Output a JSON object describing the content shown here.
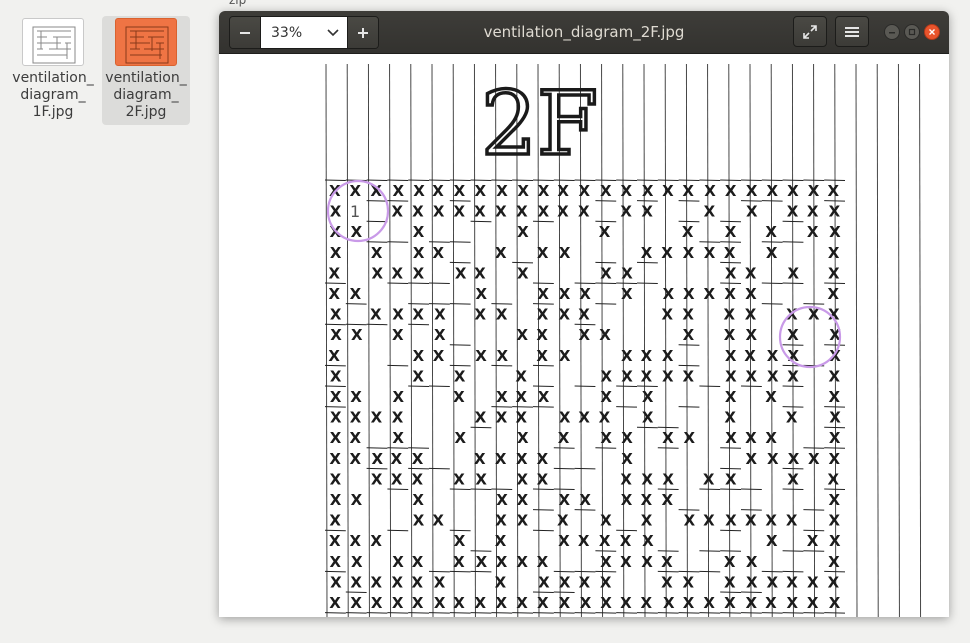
{
  "desktop": {
    "top_label": "zip",
    "files": [
      {
        "name": "ventilation_\ndiagram_\n1F.jpg",
        "selected": false
      },
      {
        "name": "ventilation_\ndiagram_\n2F.jpg",
        "selected": true
      }
    ]
  },
  "viewer": {
    "title": "ventilation_diagram_2F.jpg",
    "zoom": "33%",
    "icons": {
      "zoom_out": "minus-icon",
      "zoom_in": "plus-icon",
      "fullscreen": "fullscreen-icon",
      "menu": "hamburger-menu-icon",
      "minimize": "minimize-icon",
      "maximize": "maximize-icon",
      "close": "close-icon"
    }
  },
  "diagram": {
    "heading": "2F",
    "mark_1": "1",
    "grid_cols": 25,
    "grid_rows": 21,
    "cell_mark": "X",
    "accent_circle_color": "#c99ae8"
  },
  "colors": {
    "titlebar": "#3b3a36",
    "close": "#e9542c",
    "selected_thumb": "#ef7444"
  }
}
